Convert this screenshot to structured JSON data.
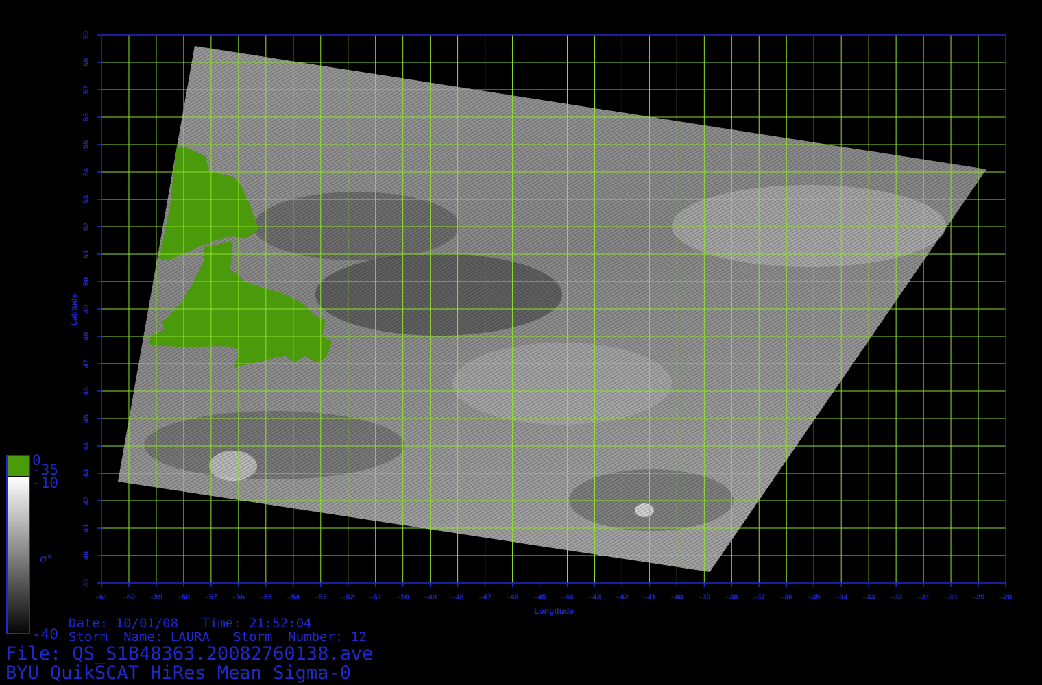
{
  "map": {
    "lon_range": [
      -61,
      -28
    ],
    "lat_range": [
      39,
      59
    ],
    "lon_ticks": [
      -61,
      -60,
      -59,
      -58,
      -57,
      -56,
      -55,
      -54,
      -53,
      -52,
      -51,
      -50,
      -49,
      -48,
      -47,
      -46,
      -45,
      -44,
      -43,
      -42,
      -41,
      -40,
      -39,
      -38,
      -37,
      -36,
      -35,
      -34,
      -33,
      -32,
      -31,
      -30,
      -29,
      -28
    ],
    "lat_ticks": [
      39,
      40,
      41,
      42,
      43,
      44,
      45,
      46,
      47,
      48,
      49,
      50,
      51,
      52,
      53,
      54,
      55,
      56,
      57,
      58,
      59
    ],
    "xlabel": "Longitude",
    "ylabel": "Latitude",
    "swath_corners_lonlat": [
      [
        -57.6,
        58.6
      ],
      [
        -28.7,
        54.1
      ],
      [
        -38.8,
        39.4
      ],
      [
        -60.4,
        42.7
      ]
    ],
    "land_color": "#4b9a0c",
    "grid_color": "#8ee02c",
    "axis_color": "#1e2ad0"
  },
  "colorbar": {
    "land_labels": [
      "0",
      "-35"
    ],
    "sigma_labels": [
      "-10",
      "-40"
    ],
    "symbol": "σ°"
  },
  "info": {
    "date_line": "Date: 10/01/08   Time: 21:52:04",
    "storm_line": "Storm  Name: LAURA   Storm  Number: 12",
    "file_line": "File: QS_S1B48363.20082760138.ave",
    "title_line": "BYU QuikSCAT HiRes Mean Sigma-0"
  }
}
